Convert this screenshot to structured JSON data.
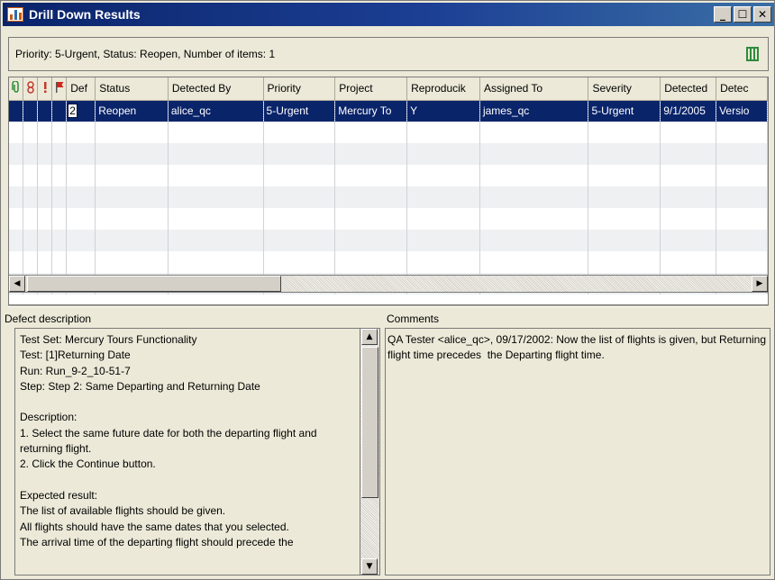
{
  "window": {
    "title": "Drill Down Results",
    "minimize_label": "_",
    "maximize_label": "☐",
    "close_label": "✕"
  },
  "summary": {
    "text": "Priority: 5-Urgent, Status: Reopen, Number of items: 1"
  },
  "grid": {
    "icon_columns": [
      "attachment-icon",
      "linked-icon",
      "urgent-icon",
      "flag-icon"
    ],
    "columns": [
      "Def",
      "Status",
      "Detected By",
      "Priority",
      "Project",
      "Reproducik",
      "Assigned To",
      "Severity",
      "Detected",
      "Detec"
    ],
    "rows": [
      {
        "cells": [
          "2",
          "Reopen",
          "alice_qc",
          "5-Urgent",
          "Mercury To",
          "Y",
          "james_qc",
          "5-Urgent",
          "9/1/2005",
          "Versio"
        ]
      }
    ]
  },
  "defect_description": {
    "label": "Defect description",
    "text": "Test Set: Mercury Tours Functionality\nTest: [1]Returning Date\nRun: Run_9-2_10-51-7\nStep: Step 2: Same Departing and Returning Date\n\nDescription:\n1. Select the same future date for both the departing flight and returning flight.\n2. Click the Continue button.\n\nExpected result:\nThe list of available flights should be given.\nAll flights should have the same dates that you selected.\nThe arrival time of the departing flight should precede the"
  },
  "comments": {
    "label": "Comments",
    "text": "QA Tester <alice_qc>, 09/17/2002: Now the list of flights is given, but Returning flight time precedes  the Departing flight time."
  },
  "colors": {
    "titlebar": "#0a246a",
    "selection": "#0a246a",
    "column_chooser": "#2e8b3b"
  }
}
